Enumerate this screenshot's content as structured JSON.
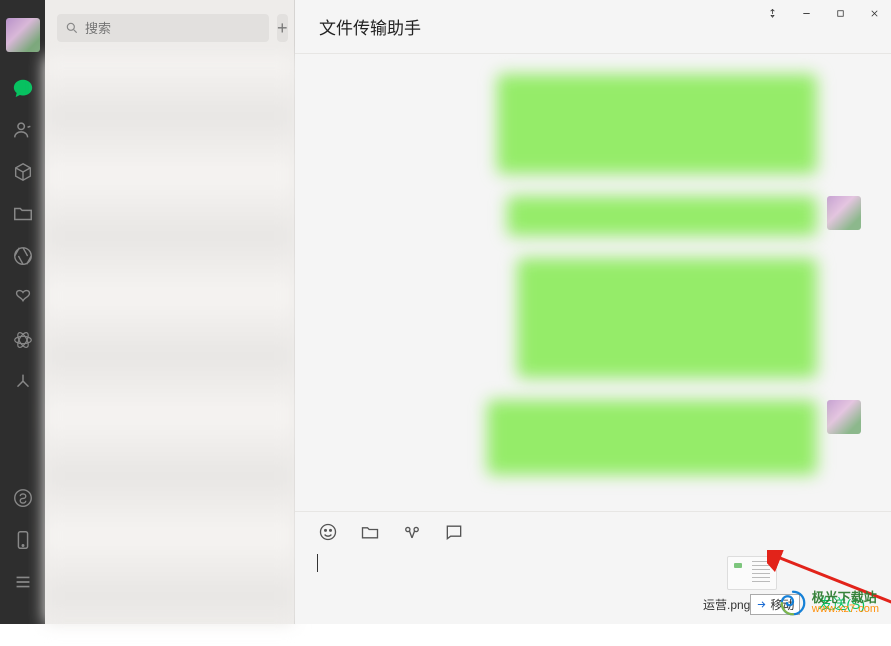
{
  "sidebar": {},
  "search": {
    "placeholder": "搜索",
    "add_symbol": "+"
  },
  "chat": {
    "title": "文件传输助手"
  },
  "attachment": {
    "filename": "运营.png",
    "action_label": "移动"
  },
  "send": {
    "label": "发送(S)"
  },
  "watermark": {
    "brand_top": "极光下载站",
    "brand_bottom": "www.xz7.com"
  }
}
